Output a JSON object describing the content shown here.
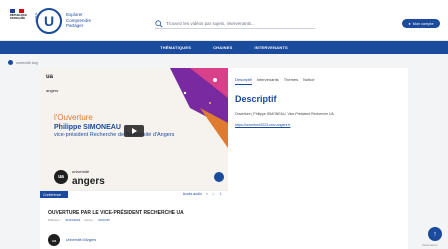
{
  "header": {
    "republic_text": "RÉPUBLIQUE FRANÇAISE",
    "logo_letter": "U",
    "logo_side": "CANAL",
    "tagline": [
      "Explorer",
      "Comprendre",
      "Partager"
    ],
    "search_placeholder": "Trouvez les vidéos par sujets, intervenants...",
    "account_label": "Mon compte",
    "colors": {
      "brand": "#1a4b9c",
      "accent": "#e07a2e"
    }
  },
  "nav": {
    "items": [
      "THÉMATIQUES",
      "CHAINES",
      "INTERVENANTS"
    ]
  },
  "breadcrumb": {
    "label": "université Ang"
  },
  "video": {
    "logo_top": "ua",
    "logo_top_sub": "angers",
    "title_line": "l'Ouverture",
    "speaker": "Philippe SIMONEAU",
    "role": "vice-président Recherche de l'université d'Angers",
    "logo_bottom_seal": "ua",
    "logo_bottom_word": "angers",
    "logo_bottom_small": "université",
    "tag": "Conférence",
    "actions": [
      "Accès audio",
      "<",
      "☆",
      "⇩"
    ]
  },
  "details": {
    "tabs": [
      "Descriptif",
      "Intervenants",
      "Thèmes",
      "Notice"
    ],
    "active_tab": "Descriptif",
    "title": "Descriptif",
    "text": "Ouverture | Philippe SIMONEAU, Vice-Président Recherche UA",
    "link": "https://ouverture2023.univ-angers.fr"
  },
  "page": {
    "title": "OUVERTURE PAR LE VICE-PRÉSIDENT RECHERCHE UA",
    "meta_date_label": "Diffusion :",
    "meta_date": "31/03/2023",
    "meta_dur_label": "Durée :",
    "meta_dur": "00:03:55",
    "channel_seal": "ua",
    "channel_name": "Université d'Angers"
  },
  "footer": {
    "fab_icon": "↑",
    "stamp": "Paramètres"
  }
}
